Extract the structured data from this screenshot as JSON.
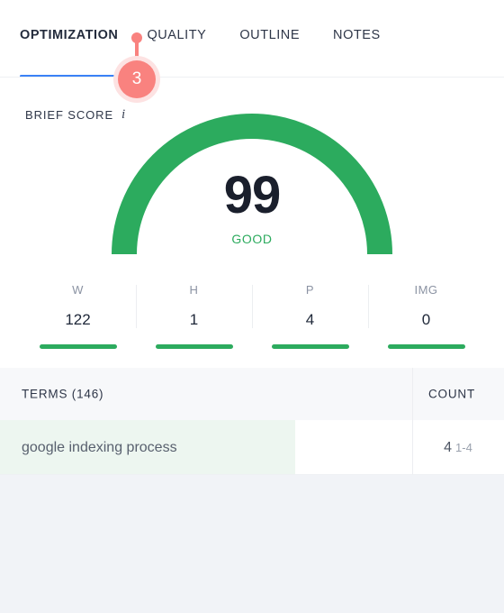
{
  "tabs": [
    {
      "label": "OPTIMIZATION",
      "active": true
    },
    {
      "label": "QUALITY",
      "active": false
    },
    {
      "label": "OUTLINE",
      "active": false
    },
    {
      "label": "NOTES",
      "active": false
    }
  ],
  "badge": {
    "count": "3",
    "color": "#f9827f",
    "halo_color": "#fde2e2"
  },
  "brief_score": {
    "label": "BRIEF SCORE",
    "info_icon": "info-icon",
    "value": "99",
    "status": "GOOD",
    "status_color": "#2cab5e",
    "max": 100,
    "arc_color": "#2cab5e"
  },
  "stats": [
    {
      "key": "W",
      "value": "122",
      "bar_color": "#2cab5e",
      "bar_fill": 100
    },
    {
      "key": "H",
      "value": "1",
      "bar_color": "#2cab5e",
      "bar_fill": 100
    },
    {
      "key": "P",
      "value": "4",
      "bar_color": "#2cab5e",
      "bar_fill": 100
    },
    {
      "key": "IMG",
      "value": "0",
      "bar_color": "#2cab5e",
      "bar_fill": 100
    }
  ],
  "terms_table": {
    "header": {
      "terms_label": "TERMS (146)",
      "count_label": "COUNT"
    },
    "rows": [
      {
        "term": "google indexing process",
        "count": "4",
        "range": "1-4",
        "highlight_color": "#edf6f0"
      }
    ]
  },
  "theme": {
    "accent_blue": "#3b82f6",
    "green": "#2cab5e",
    "pink": "#f9827f",
    "page_background": "#f1f3f7"
  }
}
